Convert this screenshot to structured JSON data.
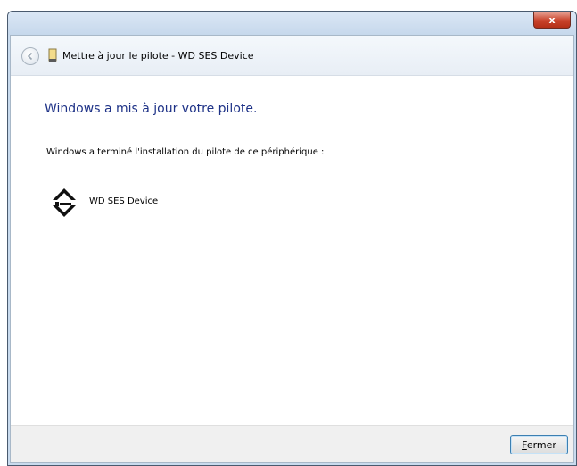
{
  "window": {
    "title": "Mettre à jour le pilote - WD SES Device",
    "close_glyph": "x"
  },
  "content": {
    "heading": "Windows a mis à jour votre pilote.",
    "message": "Windows a terminé l'installation du pilote de ce périphérique :",
    "device_name": "WD SES Device",
    "device_icon": "device-icon"
  },
  "footer": {
    "close_label_mnemonic": "F",
    "close_label_rest": "ermer"
  },
  "colors": {
    "heading": "#1e3287",
    "close_button_border": "#3c7fb1"
  }
}
